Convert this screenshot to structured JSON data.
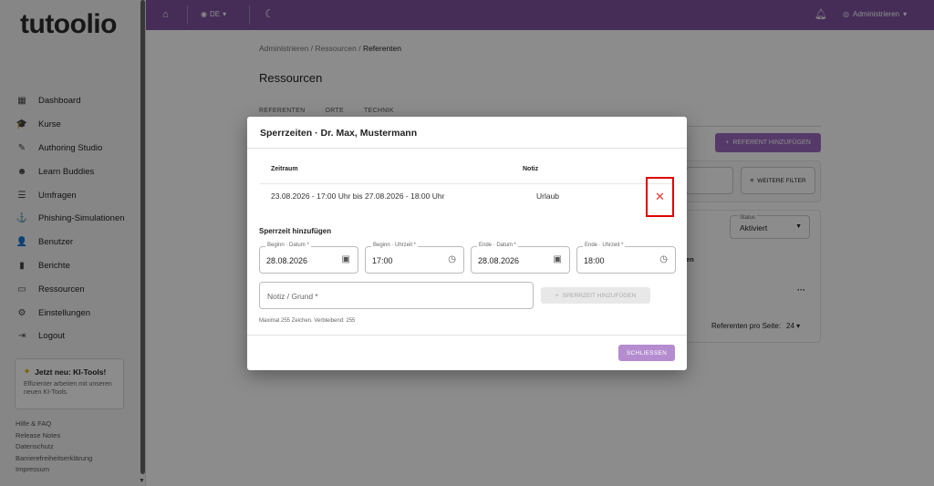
{
  "app": {
    "logo": "tutoolio"
  },
  "sidebar": {
    "items": [
      {
        "label": "Dashboard",
        "icon": "▦"
      },
      {
        "label": "Kurse",
        "icon": "🎓"
      },
      {
        "label": "Authoring Studio",
        "icon": "✎"
      },
      {
        "label": "Learn Buddies",
        "icon": "☻"
      },
      {
        "label": "Umfragen",
        "icon": "☰"
      },
      {
        "label": "Phishing-Simulationen",
        "icon": "⚓"
      },
      {
        "label": "Benutzer",
        "icon": "👤"
      },
      {
        "label": "Berichte",
        "icon": "▮"
      },
      {
        "label": "Ressourcen",
        "icon": "▭"
      },
      {
        "label": "Einstellungen",
        "icon": "⚙"
      },
      {
        "label": "Logout",
        "icon": "⇥"
      }
    ],
    "promo": {
      "title": "Jetzt neu: KI-Tools!",
      "desc": "Effizienter arbeiten mit unseren neuen KI-Tools."
    },
    "footer_links": [
      "Hilfe & FAQ",
      "Release Notes",
      "Datenschutz",
      "Barrierefreiheitserklärung",
      "Impressum"
    ]
  },
  "topbar": {
    "lang": "DE",
    "user": "Administrieren"
  },
  "breadcrumb": {
    "a": "Administrieren",
    "b": "Ressourcen",
    "c": "Referenten",
    "sep": "/"
  },
  "page": {
    "title": "Ressourcen",
    "tabs": [
      "REFERENTEN",
      "ORTE",
      "TECHNIK"
    ],
    "add_button": "REFERENT HINZUFÜGEN",
    "filter_button": "WEITERE FILTER",
    "status_label": "Status",
    "status_value": "Aktiviert",
    "col_fragment": "en",
    "per_page_label": "Referenten pro Seite:",
    "per_page_value": "24"
  },
  "dialog": {
    "title": "Sperrzeiten · Dr. Max, Mustermann",
    "col_zeitraum": "Zeitraum",
    "col_notiz": "Notiz",
    "row": {
      "zeitraum": "23.08.2026 - 17:00 Uhr bis 27.08.2026 - 18:00 Uhr",
      "notiz": "Urlaub"
    },
    "add_title": "Sperrzeit hinzufügen",
    "fields": {
      "begin_date_label": "Beginn · Datum *",
      "begin_date": "28.08.2026",
      "begin_time_label": "Beginn · Uhrzeit *",
      "begin_time": "17:00",
      "end_date_label": "Ende · Datum *",
      "end_date": "28.08.2026",
      "end_time_label": "Ende · Uhrzeit *",
      "end_time": "18:00"
    },
    "note_placeholder": "Notiz / Grund *",
    "add_button": "SPERRZEIT HINZUFÜGEN",
    "hint": "Maximal 255 Zeichen. Verbleibend: 255",
    "close_button": "SCHLIESSEN"
  },
  "colors": {
    "primary": "#7e52a0",
    "accent": "#9b6bbf",
    "danger": "#e53935"
  }
}
